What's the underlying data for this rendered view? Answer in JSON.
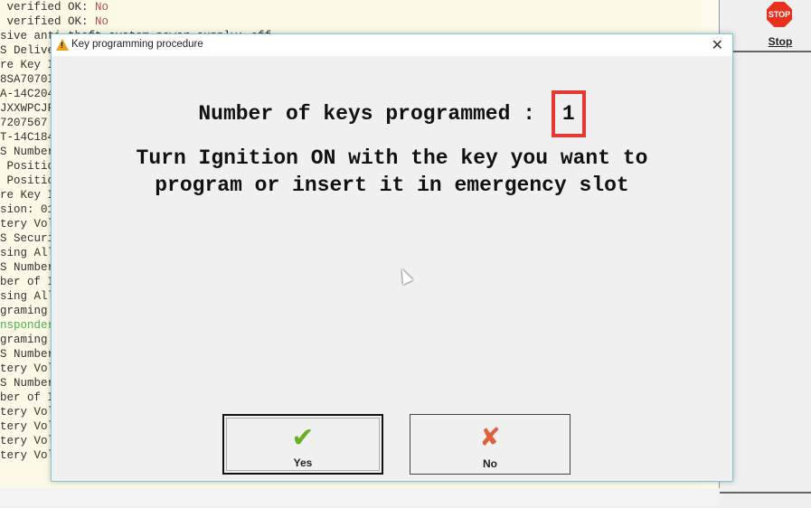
{
  "log": {
    "lines": [
      {
        "text": " verified OK: ",
        "value": "No"
      },
      {
        "text": " verified OK: ",
        "value": "No"
      },
      {
        "text": "sive anti-theft system power supply: off"
      },
      {
        "text": "S Delive"
      },
      {
        "text": "re Key I"
      },
      {
        "text": "8SA7070I"
      },
      {
        "text": "A-14C204"
      },
      {
        "text": "JXXWPCJF"
      },
      {
        "text": "7207567"
      },
      {
        "text": "T-14C184"
      },
      {
        "text": "S Number"
      },
      {
        "text": " Positic"
      },
      {
        "text": " Positic"
      },
      {
        "text": "re Key I"
      },
      {
        "text": "sion: 01"
      },
      {
        "text": "tery Vol"
      },
      {
        "text": "S Securi"
      },
      {
        "text": "sing All"
      },
      {
        "text": "S Number"
      },
      {
        "text": "ber of I"
      },
      {
        "text": "sing All"
      },
      {
        "text": "graming "
      },
      {
        "text": "nsponder",
        "green": true
      },
      {
        "text": "graming "
      },
      {
        "text": "S Number"
      },
      {
        "text": "tery Vol"
      },
      {
        "text": "S Number"
      },
      {
        "text": "ber of I"
      },
      {
        "text": "tery Vol"
      },
      {
        "text": "tery Vol"
      },
      {
        "text": "tery Vol"
      },
      {
        "text": "tery Vol"
      }
    ]
  },
  "side": {
    "stop_icon_text": "STOP",
    "stop_label": "Stop"
  },
  "dialog": {
    "title": "Key programming procedure",
    "title_icon": "warning-icon",
    "close_glyph": "✕",
    "keys_label": "Number of keys programmed :",
    "keys_count": "1",
    "instruction_line1": "Turn Ignition ON with the key you want to",
    "instruction_line2": "program or insert it in emergency slot",
    "yes": {
      "label": "Yes",
      "icon": "checkmark-icon",
      "glyph": "✔"
    },
    "no": {
      "label": "No",
      "icon": "cross-icon",
      "glyph": "✘"
    },
    "highlight_color": "#e53935"
  }
}
